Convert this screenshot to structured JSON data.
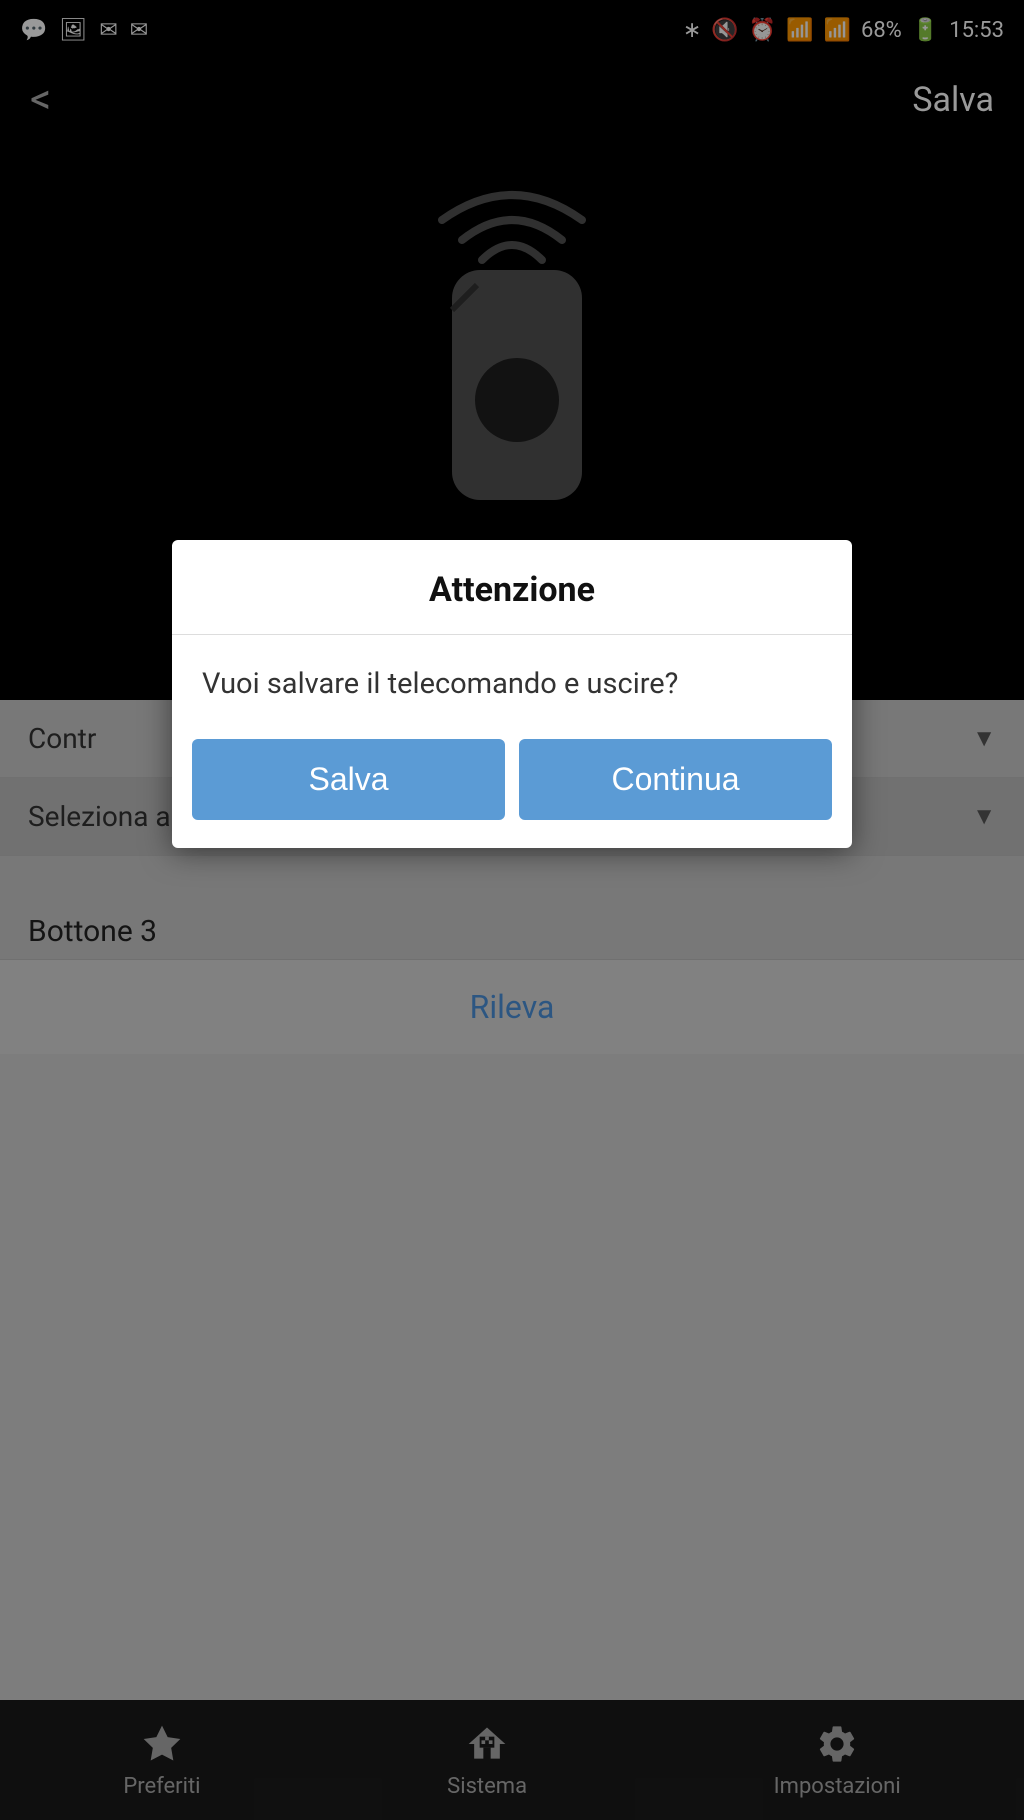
{
  "statusBar": {
    "battery": "68%",
    "time": "15:53"
  },
  "topNav": {
    "back": "<",
    "save": "Salva"
  },
  "dialog": {
    "title": "Attenzione",
    "body": "Vuoi salvare il telecomando e uscire?",
    "saveBtn": "Salva",
    "continueBtn": "Continua"
  },
  "content": {
    "controllo": "Contr",
    "seleziona": "Seleziona automazione",
    "bottone": "Bottone 3",
    "rileva": "Rileva"
  },
  "tabs": {
    "preferiti": "Preferiti",
    "sistema": "Sistema",
    "impostazioni": "Impostazioni"
  }
}
